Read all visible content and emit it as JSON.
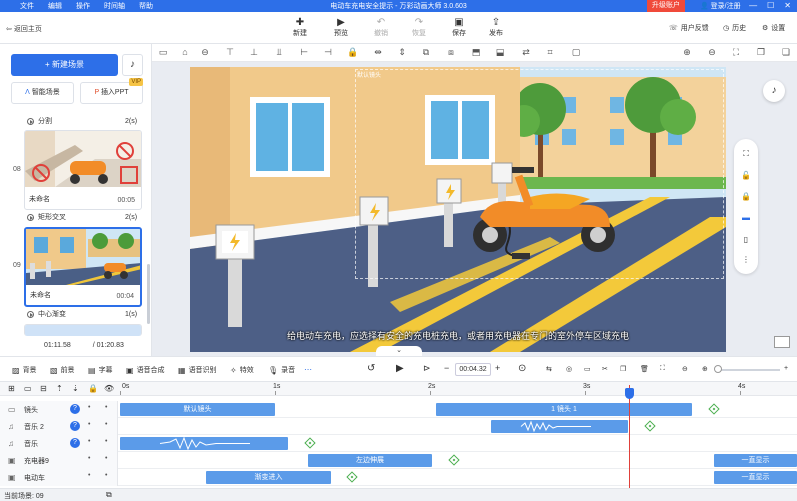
{
  "app": {
    "title": "电动车充电安全提示 - 万彩动画大师 3.0.603",
    "menu": [
      "文件",
      "编辑",
      "操作",
      "时间轴",
      "帮助"
    ],
    "upgrade": "升级账户",
    "login": "登录/注册",
    "window_controls": [
      "—",
      "☐",
      "✕"
    ]
  },
  "toolbar": {
    "back": "返回主页",
    "tools": [
      {
        "label": "新建",
        "icon": "plus-doc-icon"
      },
      {
        "label": "预览",
        "icon": "play-icon"
      },
      {
        "label": "撤销",
        "icon": "undo-icon"
      },
      {
        "label": "恢复",
        "icon": "redo-icon"
      },
      {
        "label": "保存",
        "icon": "save-icon"
      },
      {
        "label": "发布",
        "icon": "publish-icon"
      }
    ],
    "right": [
      {
        "label": "用户反馈",
        "icon": "feedback-icon"
      },
      {
        "label": "历史",
        "icon": "history-icon"
      },
      {
        "label": "设置",
        "icon": "gear-icon"
      }
    ]
  },
  "left": {
    "new_scene": "新建场景",
    "smart_scene": "智能场景",
    "insert_ppt": "插入PPT",
    "vip": "VIP",
    "transitions": [
      {
        "name": "分割",
        "dur": "2(s)"
      },
      {
        "name": "矩形交叉",
        "dur": "2(s)"
      },
      {
        "name": "中心渐变",
        "dur": "1(s)"
      }
    ],
    "scenes": [
      {
        "num": "08",
        "name": "未命名",
        "dur": "00:05"
      },
      {
        "num": "09",
        "name": "未命名",
        "dur": "00:04"
      }
    ],
    "time_current": "01:11.58",
    "time_total": "01:20.83"
  },
  "stage": {
    "camera_label": "默认镜头",
    "subtitle": "给电动车充电，应选择有安全的充电桩充电，或者用充电器在专门的室外停车区域充电"
  },
  "timeline_toolbar": {
    "items": [
      {
        "label": "背景",
        "icon": "background-icon"
      },
      {
        "label": "前景",
        "icon": "foreground-icon"
      },
      {
        "label": "字幕",
        "icon": "subtitle-icon"
      },
      {
        "label": "语音合成",
        "icon": "voice-synthesis-icon"
      },
      {
        "label": "语音识别",
        "icon": "voice-recognition-icon"
      },
      {
        "label": "特效",
        "icon": "effects-icon"
      },
      {
        "label": "录音",
        "icon": "record-icon"
      }
    ],
    "current_time": "00:04.32",
    "minus": "−",
    "plus": "+"
  },
  "timeline": {
    "ruler": [
      "0s",
      "1s",
      "2s",
      "3s",
      "4s"
    ],
    "tracks": [
      {
        "name": "镜头",
        "icon": "camera-icon",
        "clips": [
          {
            "label": "默认镜头"
          },
          {
            "label": "1 镜头 1"
          }
        ]
      },
      {
        "name": "音乐 2",
        "icon": "music-icon",
        "clips": [
          {
            "label": ""
          }
        ]
      },
      {
        "name": "音乐",
        "icon": "music-icon",
        "clips": [
          {
            "label": ""
          }
        ]
      },
      {
        "name": "充电器9",
        "icon": "image-icon",
        "clips": [
          {
            "label": "左边伸展"
          },
          {
            "label": "一直显示"
          }
        ]
      },
      {
        "name": "电动车",
        "icon": "image-icon",
        "clips": [
          {
            "label": "渐变进入"
          },
          {
            "label": "一直显示"
          }
        ]
      }
    ]
  },
  "status": {
    "current_scene": "当前场景: 09"
  },
  "colors": {
    "primary": "#2d6fe8",
    "upgrade": "#f04a3a",
    "clip": "#5b9be9",
    "playhead": "#e0403a",
    "keyframe": "#4caf50"
  }
}
